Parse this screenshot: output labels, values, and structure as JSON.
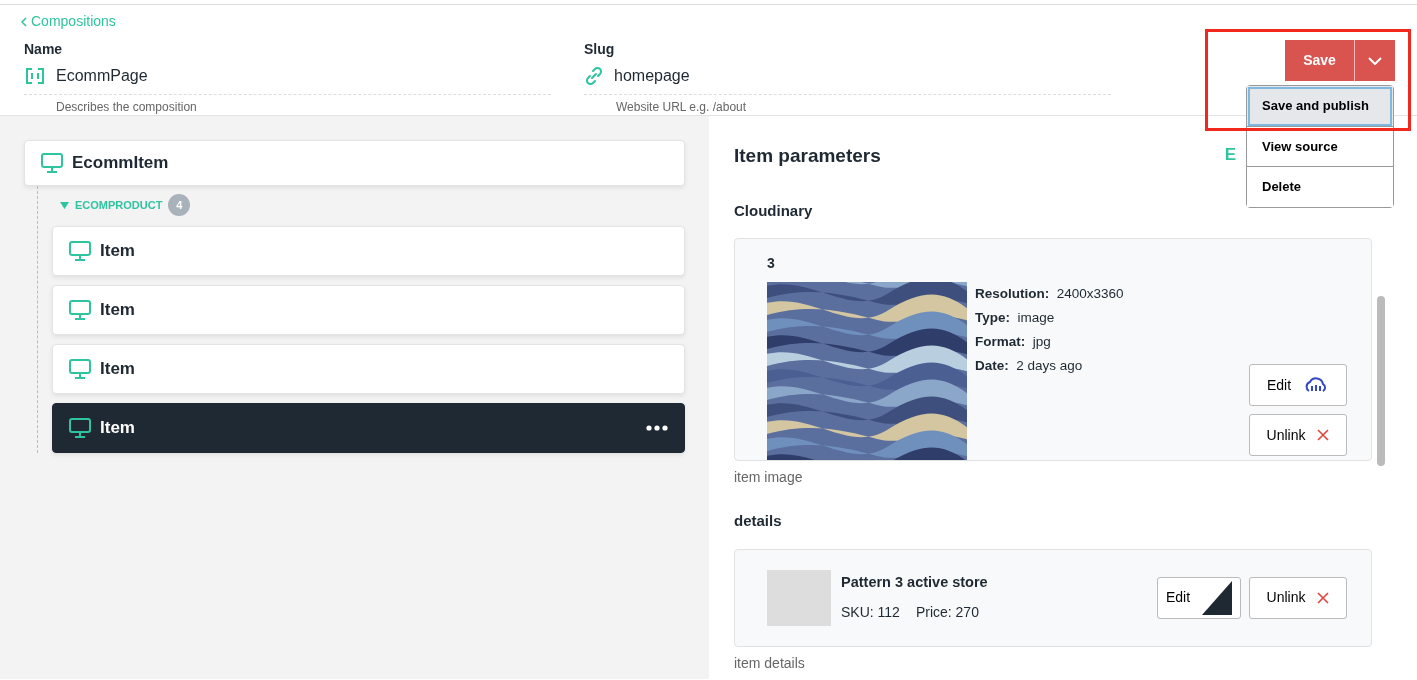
{
  "back_link": "Compositions",
  "name_field": {
    "label": "Name",
    "value": "EcommPage",
    "hint": "Describes the composition"
  },
  "slug_field": {
    "label": "Slug",
    "value": "homepage",
    "hint": "Website URL e.g. /about"
  },
  "save_button": "Save",
  "menu": [
    {
      "label": "Save and publish",
      "selected": true
    },
    {
      "label": "View source",
      "selected": false
    },
    {
      "label": "Delete",
      "selected": false
    }
  ],
  "tree": {
    "label": "EcommItem",
    "slot": {
      "label": "ECOMPRODUCT",
      "count": "4",
      "expanded": true,
      "children": [
        {
          "label": "Item",
          "selected": false
        },
        {
          "label": "Item",
          "selected": false
        },
        {
          "label": "Item",
          "selected": false
        },
        {
          "label": "Item",
          "selected": true
        }
      ]
    }
  },
  "params": {
    "title": "Item parameters",
    "title_link": "E",
    "sections": [
      {
        "heading": "Cloudinary",
        "card": {
          "title": "3",
          "meta": [
            {
              "label": "Resolution:",
              "value": "2400x3360"
            },
            {
              "label": "Type:",
              "value": "image"
            },
            {
              "label": "Format:",
              "value": "jpg"
            },
            {
              "label": "Date:",
              "value": "2 days ago"
            }
          ],
          "buttons": [
            "Edit",
            "Unlink"
          ]
        },
        "caption": "item image"
      },
      {
        "kind": "product",
        "heading": "details",
        "card": {
          "title": "Pattern 3 active store",
          "meta": [
            {
              "label": "SKU:",
              "value": "112"
            },
            {
              "label": "Price:",
              "value": "270"
            }
          ],
          "buttons": [
            "Edit",
            "Unlink"
          ]
        },
        "caption": "item details"
      }
    ]
  }
}
